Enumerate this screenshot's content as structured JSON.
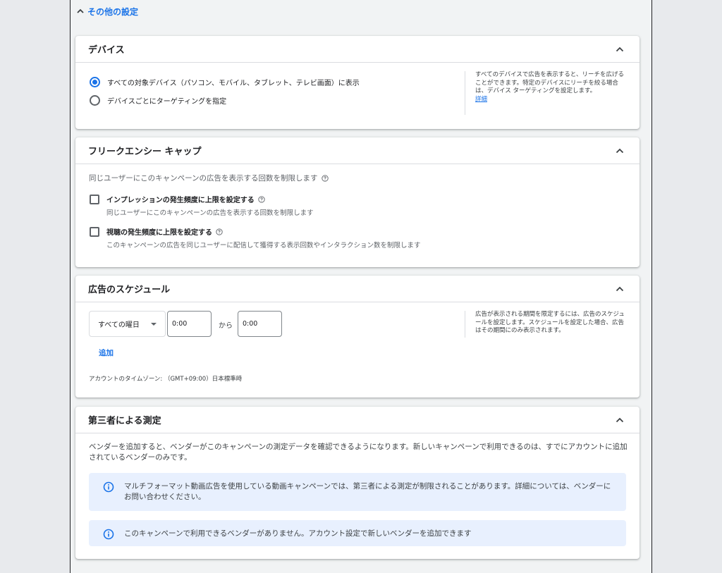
{
  "section": {
    "title": "その他の設定"
  },
  "device": {
    "title": "デバイス",
    "options": [
      {
        "label": "すべての対象デバイス（パソコン、モバイル、タブレット、テレビ画面）に表示",
        "selected": true
      },
      {
        "label": "デバイスごとにターゲティングを指定",
        "selected": false
      }
    ],
    "help_text": "すべてのデバイスで広告を表示すると、リーチを広げることができます。特定のデバイスにリーチを絞る場合は、デバイス ターゲティングを設定します。",
    "help_link": "詳細"
  },
  "frequency": {
    "title": "フリークエンシー キャップ",
    "description": "同じユーザーにこのキャンペーンの広告を表示する回数を制限します",
    "options": [
      {
        "label": "インプレッションの発生頻度に上限を設定する",
        "sub": "同じユーザーにこのキャンペーンの広告を表示する回数を制限します"
      },
      {
        "label": "視聴の発生頻度に上限を設定する",
        "sub": "このキャンペーンの広告を同じユーザーに配信して獲得する表示回数やインタラクション数を制限します"
      }
    ]
  },
  "schedule": {
    "title": "広告のスケジュール",
    "day_select": "すべての曜日",
    "start_time": "0:00",
    "from_label": "から",
    "end_time": "0:00",
    "add_label": "追加",
    "timezone": "アカウントのタイムゾーン: （GMT+09:00）日本標準時",
    "help_text": "広告が表示される期間を限定するには、広告のスケジュールを設定します。スケジュールを設定した場合、広告はその期間にのみ表示されます。"
  },
  "third_party": {
    "title": "第三者による測定",
    "description": "ベンダーを追加すると、ベンダーがこのキャンペーンの測定データを確認できるようになります。新しいキャンペーンで利用できるのは、すでにアカウントに追加されているベンダーのみです。",
    "notice_1": "マルチフォーマット動画広告を使用している動画キャンペーンでは、第三者による測定が制限されることがあります。詳細については、ベンダーにお問い合わせください。",
    "notice_2": "このキャンペーンで利用できるベンダーがありません。アカウント設定で新しいベンダーを追加できます"
  },
  "colors": {
    "accent": "#1a73e8",
    "banner": "#e8f0fe",
    "background": "#f1f3f4"
  },
  "icons": [
    "chevron-up-icon",
    "help-circle-icon",
    "info-icon",
    "dropdown-caret-icon"
  ]
}
